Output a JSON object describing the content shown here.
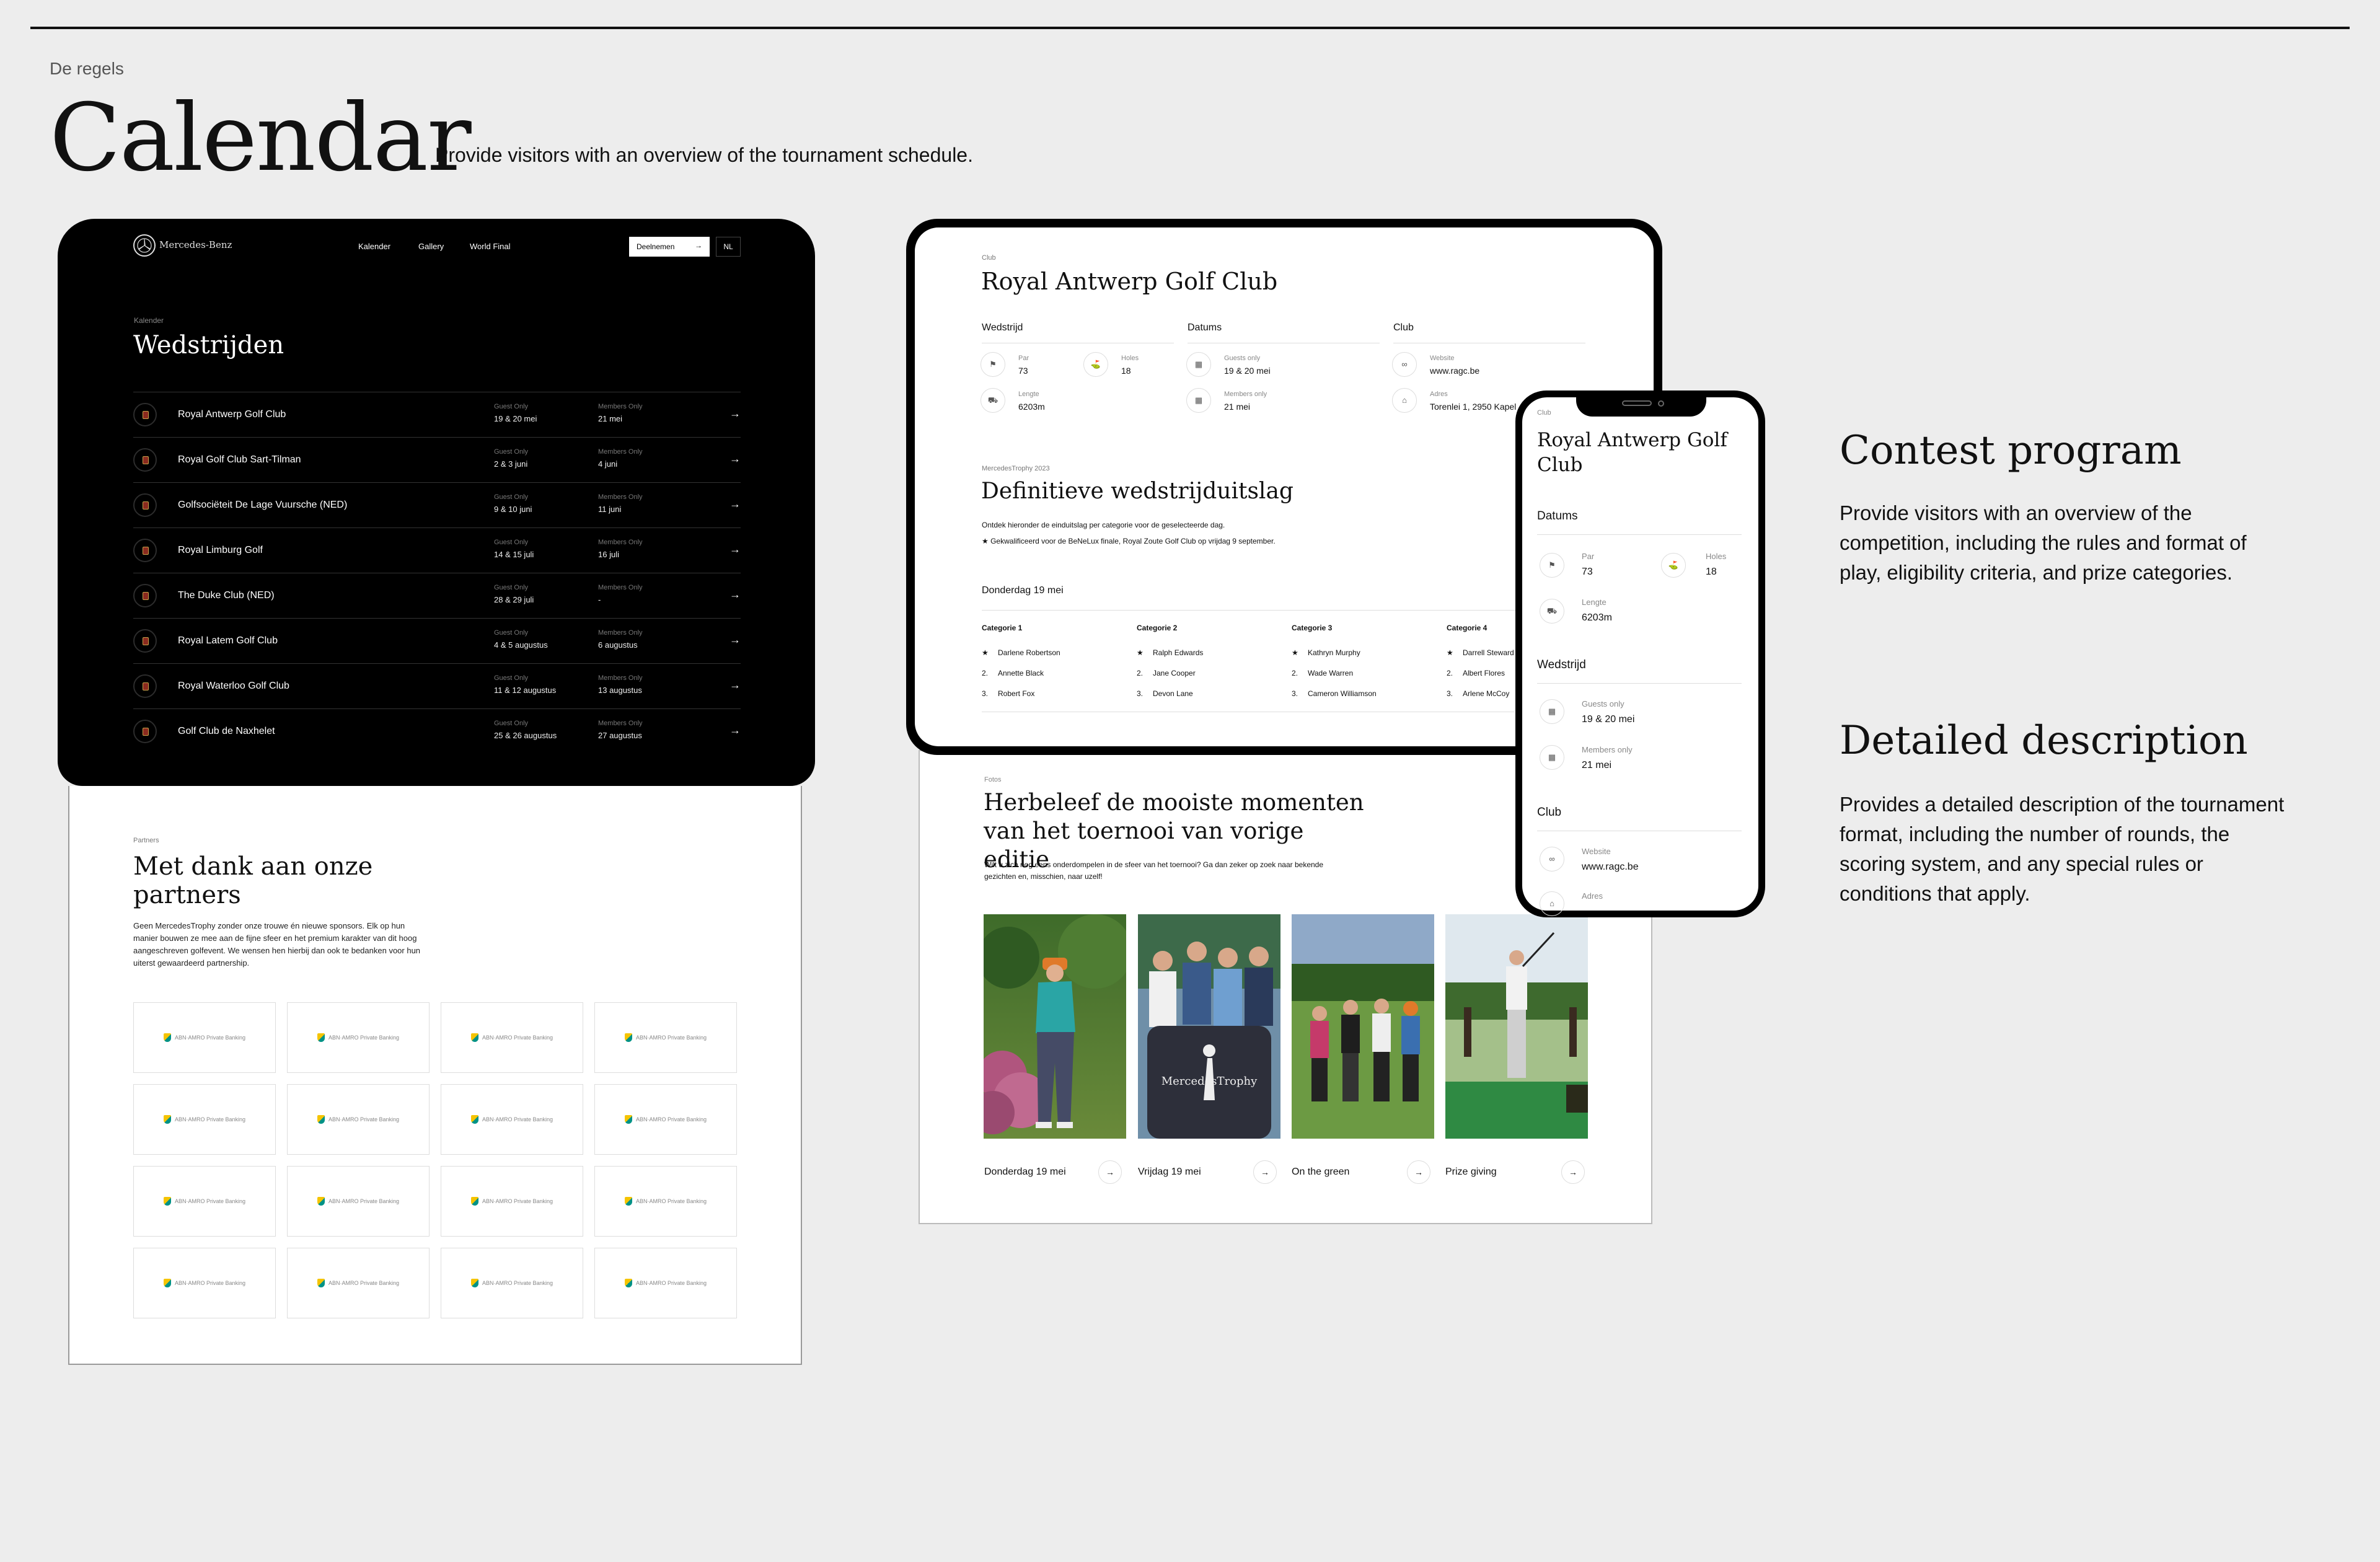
{
  "page": {
    "kicker": "De regels",
    "title": "Calendar",
    "intro": "Provide visitors with an overview of the tournament schedule."
  },
  "desktop": {
    "nav": {
      "brand": "Mercedes-Benz",
      "links": [
        "Kalender",
        "Gallery",
        "World Final"
      ],
      "cta": "Deelnemen",
      "cta_arrow": "→",
      "lang": "NL"
    },
    "kicker": "Kalender",
    "title": "Wedstrijden",
    "rows": [
      {
        "name": "Royal Antwerp Golf Club",
        "guest_label": "Guest Only",
        "guest": "19 & 20 mei",
        "member_label": "Members Only",
        "member": "21 mei"
      },
      {
        "name": "Royal Golf Club Sart-Tilman",
        "guest_label": "Guest Only",
        "guest": "2 & 3 juni",
        "member_label": "Members Only",
        "member": "4 juni"
      },
      {
        "name": "Golfsociëteit De Lage Vuursche (NED)",
        "guest_label": "Guest Only",
        "guest": "9 & 10 juni",
        "member_label": "Members Only",
        "member": "11 juni"
      },
      {
        "name": "Royal Limburg Golf",
        "guest_label": "Guest Only",
        "guest": "14 & 15 juli",
        "member_label": "Members Only",
        "member": "16 juli"
      },
      {
        "name": "The Duke Club (NED)",
        "guest_label": "Guest Only",
        "guest": "28 & 29 juli",
        "member_label": "Members Only",
        "member": "-"
      },
      {
        "name": "Royal Latem Golf Club",
        "guest_label": "Guest Only",
        "guest": "4 & 5 augustus",
        "member_label": "Members Only",
        "member": "6 augustus"
      },
      {
        "name": "Royal Waterloo Golf Club",
        "guest_label": "Guest Only",
        "guest": "11 & 12 augustus",
        "member_label": "Members Only",
        "member": "13 augustus"
      },
      {
        "name": "Golf Club de Naxhelet",
        "guest_label": "Guest Only",
        "guest": "25 & 26 augustus",
        "member_label": "Members Only",
        "member": "27 augustus"
      }
    ],
    "row_arrow": "→",
    "partners": {
      "kicker": "Partners",
      "title": "Met dank aan onze partners",
      "desc": "Geen MercedesTrophy zonder onze trouwe én nieuwe sponsors. Elk op hun manier bouwen ze mee aan de fijne sfeer en het premium karakter van dit hoog aangeschreven golfevent. We wensen hen hierbij dan ook te bedanken voor hun uiterst gewaardeerd partnership.",
      "logo_text": "ABN·AMRO Private Banking",
      "logo_count": 16
    }
  },
  "tablet": {
    "kicker": "Club",
    "title": "Royal Antwerp Golf Club",
    "cols": {
      "wedstrijd": "Wedstrijd",
      "datums": "Datums",
      "club": "Club"
    },
    "par_label": "Par",
    "par": "73",
    "holes_label": "Holes",
    "holes": "18",
    "length_label": "Lengte",
    "length": "6203m",
    "guests_label": "Guests only",
    "guests": "19 & 20 mei",
    "members_label": "Members only",
    "members": "21 mei",
    "website_label": "Website",
    "website": "www.ragc.be",
    "address_label": "Adres",
    "address": "Torenlei 1, 2950 Kapellen",
    "result_kicker": "MercedesTrophy 2023",
    "result_title": "Definitieve wedstrijduitslag",
    "result_desc": "Ontdek hieronder de einduitslag per categorie voor de geselecteerde dag.",
    "result_note": "Gekwalificeerd voor de BeNeLux finale, Royal Zoute Golf Club op vrijdag 9 september.",
    "day": "Donderdag 19 mei",
    "categories": [
      {
        "name": "Categorie 1",
        "players": [
          "Darlene Robertson",
          "Annette Black",
          "Robert Fox"
        ]
      },
      {
        "name": "Categorie 2",
        "players": [
          "Ralph Edwards",
          "Jane Cooper",
          "Devon Lane"
        ]
      },
      {
        "name": "Categorie 3",
        "players": [
          "Kathryn Murphy",
          "Wade Warren",
          "Cameron Williamson"
        ]
      },
      {
        "name": "Categorie 4",
        "players": [
          "Darrell Steward",
          "Albert Flores",
          "Arlene McCoy"
        ]
      }
    ],
    "ranks": [
      "★",
      "2.",
      "3."
    ]
  },
  "gallery": {
    "kicker": "Fotos",
    "title": "Herbeleef de mooiste momenten van het toernooi van vorige editie",
    "desc": "Wilt u zich nog eens onderdompelen in de sfeer van het toernooi? Ga dan zeker op zoek naar bekende gezichten en, misschien, naar uzelf!",
    "banner_text": "MercedesTrophy",
    "captions": [
      "Donderdag 19 mei",
      "Vrijdag 19 mei",
      "On the green",
      "Prize giving"
    ],
    "arrow": "→"
  },
  "phone": {
    "kicker": "Club",
    "title": "Royal Antwerp Golf Club",
    "sec_datums": "Datums",
    "par_label": "Par",
    "par": "73",
    "holes_label": "Holes",
    "holes": "18",
    "length_label": "Lengte",
    "length": "6203m",
    "sec_wedstrijd": "Wedstrijd",
    "guests_label": "Guests only",
    "guests": "19 & 20 mei",
    "members_label": "Members only",
    "members": "21 mei",
    "sec_club": "Club",
    "website_label": "Website",
    "website": "www.ragc.be",
    "address_label": "Adres"
  },
  "aside": {
    "h1": "Contest program",
    "p1": "Provide visitors with an overview of the competition, including the rules and format of play, eligibility criteria, and prize categories.",
    "h2": "Detailed description",
    "p2": "Provides a detailed description of the tournament format, including the number of rounds, the scoring system, and any special rules or conditions that apply."
  }
}
